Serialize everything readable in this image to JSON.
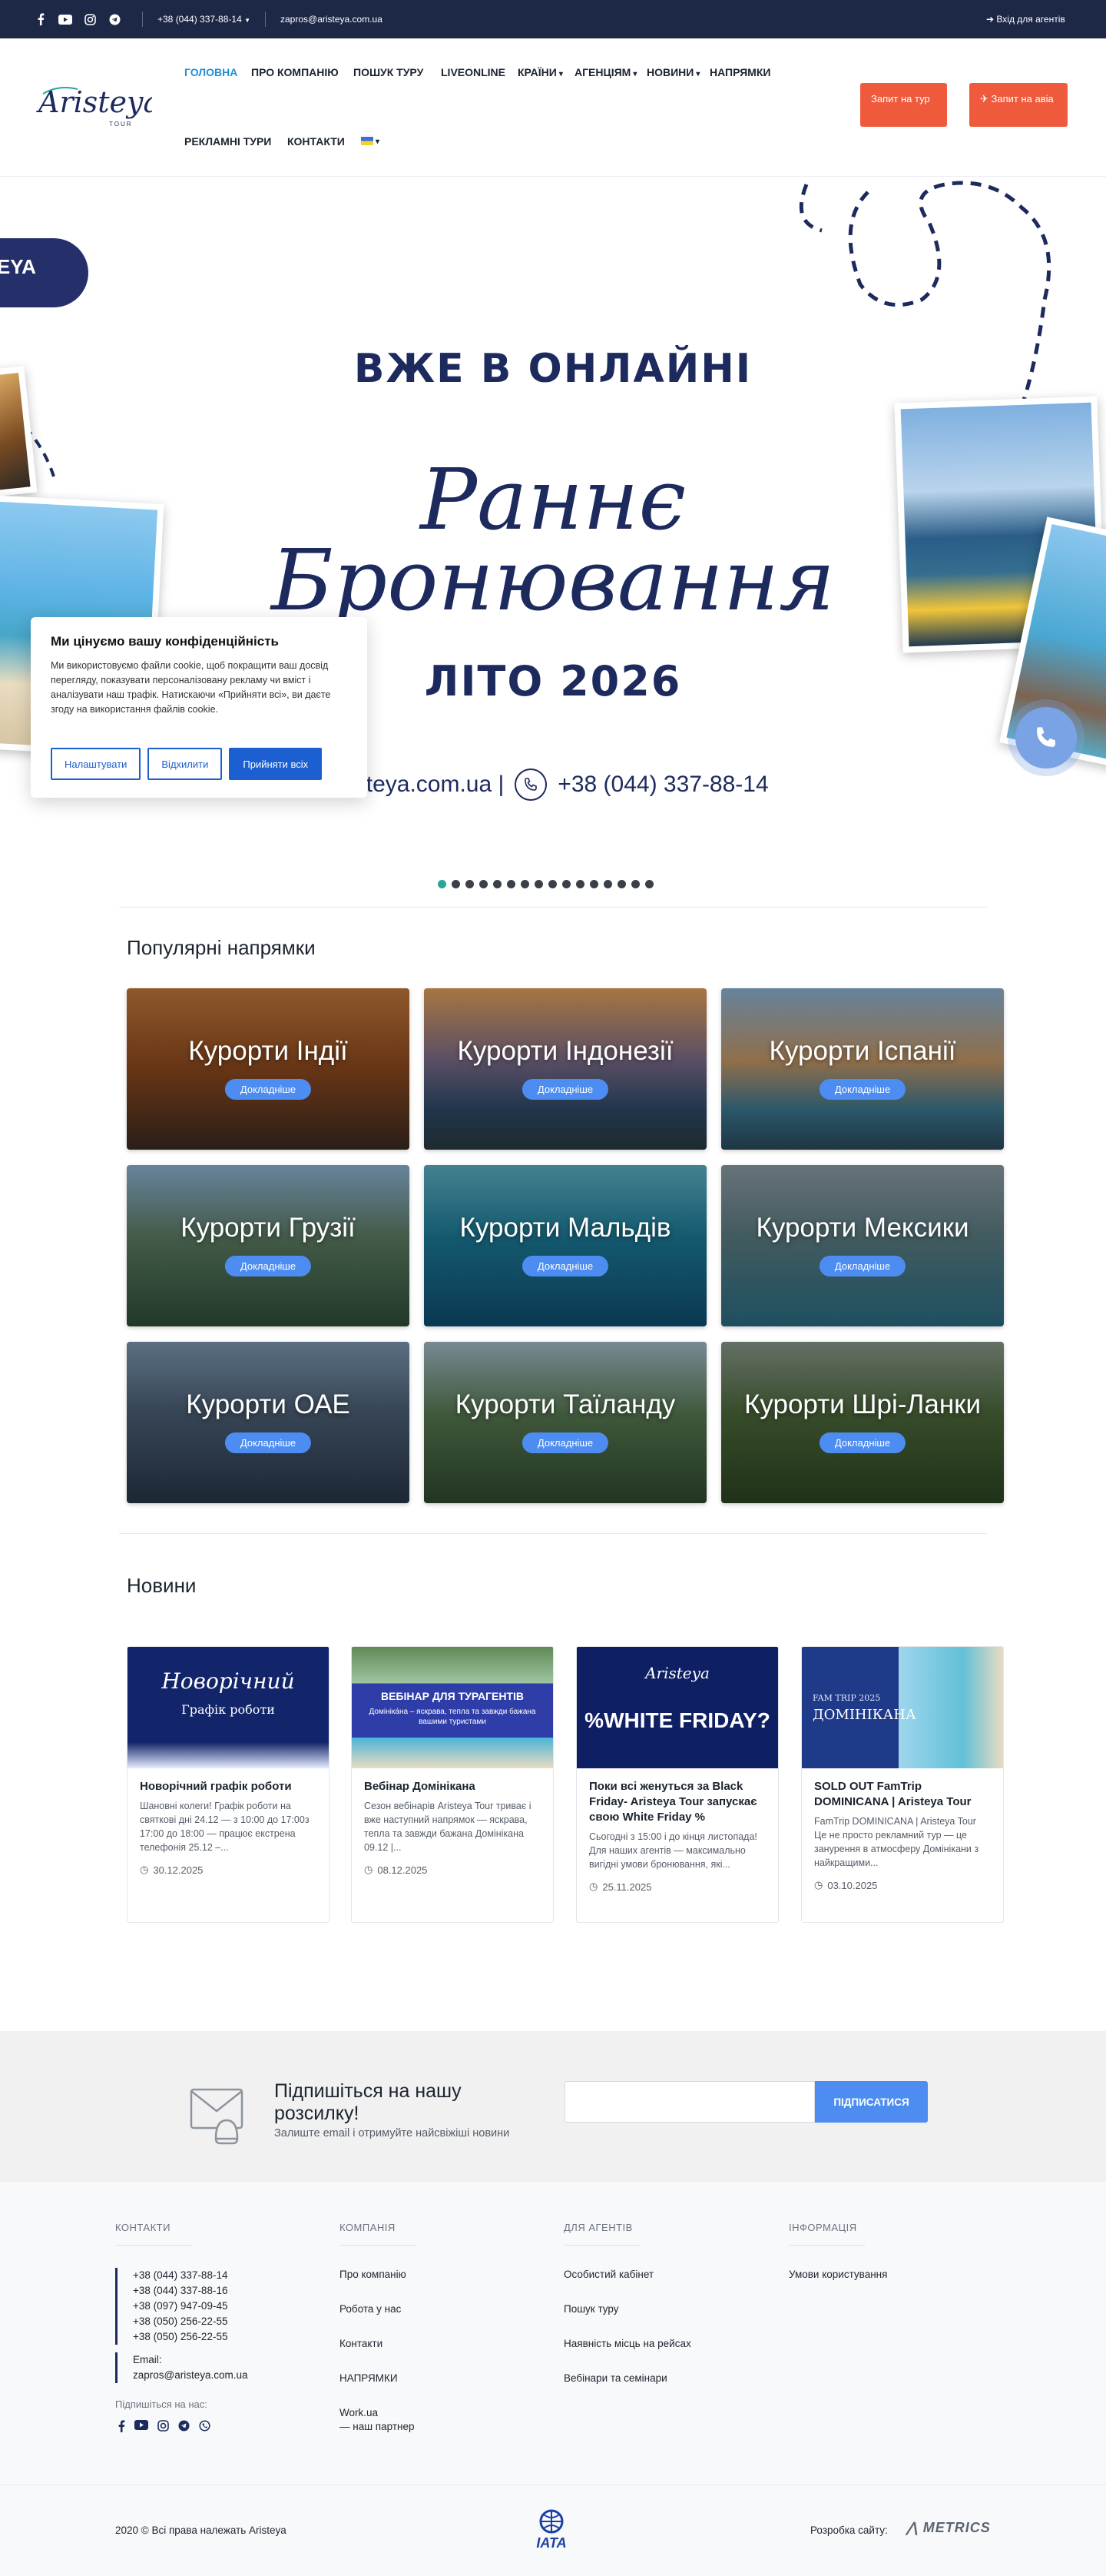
{
  "topbar": {
    "phone": "+38 (044) 337-88-14",
    "email": "zapros@aristeya.com.ua",
    "agent_login": "Вхід для агентів",
    "social_icons": [
      "facebook-icon",
      "youtube-icon",
      "instagram-icon",
      "telegram-icon"
    ]
  },
  "header": {
    "logo_text": "Aristeya",
    "logo_sub": "TOUR",
    "nav": {
      "home": "ГОЛОВНА",
      "about": "ПРО КОМПАНІЮ",
      "search": "ПОШУК ТУРУ",
      "liveonline": "LIVEONLINE",
      "countries": "КРАЇНИ",
      "agencies": "АГЕНЦІЯМ",
      "news": "НОВИНИ",
      "directions": "НАПРЯМКИ",
      "ad_tours": "РЕКЛАМНІ ТУРИ",
      "contacts": "КОНТАКТИ"
    },
    "btn_tour": "Запит на тур",
    "btn_avia": "Запит на авіа"
  },
  "hero": {
    "pill_text": "TEYA",
    "line1": "ВЖЕ В ОНЛАЙНІ",
    "script1": "Раннє",
    "script2": "Бронювання",
    "line2": "ЛІТО 2026",
    "site": "online.aristeya.com.ua |",
    "phone": "+38 (044) 337-88-14",
    "slides_total": 16,
    "slide_active": 1
  },
  "cookie": {
    "title": "Ми цінуємо вашу конфіденційність",
    "text": "Ми використовуємо файли cookie, щоб покращити ваш досвід перегляду, показувати персоналізовану рекламу чи вміст і аналізувати наш трафік. Натискаючи «Прийняти всі», ви даєте згоду на використання файлів cookie.",
    "btn_settings": "Налаштувати",
    "btn_reject": "Відхилити",
    "btn_accept": "Прийняти всіх"
  },
  "popular": {
    "title": "Популярні напрямки",
    "more_label": "Докладніше",
    "items": [
      {
        "name": "Курорти Індії"
      },
      {
        "name": "Курорти Індонезії"
      },
      {
        "name": "Курорти Іспанії"
      },
      {
        "name": "Курорти Грузії"
      },
      {
        "name": "Курорти Мальдів"
      },
      {
        "name": "Курорти Мексики"
      },
      {
        "name": "Курорти ОАЕ"
      },
      {
        "name": "Курорти Таїланду"
      },
      {
        "name": "Курорти Шрі-Ланки"
      }
    ]
  },
  "news": {
    "title": "Новини",
    "items": [
      {
        "image_line1": "Новорічний",
        "image_line2": "Графік роботи",
        "title": "Новорічний графік роботи",
        "text": "Шановні колеги! Графік роботи на святкові дні 24.12 — з 10:00 до 17:00з 17:00 до 18:00 — працює екстрена телефонія 25.12 –...",
        "date": "30.12.2025"
      },
      {
        "image_line1": "ВЕБІНАР ДЛЯ ТУРАГЕНТІВ",
        "image_line2": "Домініка́на – яскрава, тепла та завжди бажана вашими туристами",
        "title": "Вебінар Домінікана",
        "text": "Сезон вебінарів Aristeya Tour триває і вже наступний напрямок — яскрава, тепла та завжди бажана Домінікана 09.12 |...",
        "date": "08.12.2025"
      },
      {
        "image_line1": "Aristeya",
        "image_line2": "%WHITE FRIDAY?",
        "title": "Поки всі женуться за Black Friday- Aristeya Tour запускає свою White Friday %",
        "text": "  Сьогодні з 15:00 і до кінця листопада! Для наших агентів — максимально вигідні умови бронювання, які...",
        "date": "25.11.2025"
      },
      {
        "image_line1": "FAM TRIP 2025",
        "image_line2": "ДОМІНІКАНА",
        "title": "SOLD OUT FamTrip DOMINICANA | Aristeya Tour",
        "text": "FamTrip DOMINICANA | Aristeya Tour Це не просто рекламний тур — це занурення в атмосферу Домінікани з найкращими...",
        "date": "03.10.2025"
      }
    ]
  },
  "subscribe": {
    "title": "Підпишіться на нашу розсилку!",
    "subtitle": "Залиште email і отримуйте найсвіжіші новини",
    "button": "ПІДПИСАТИСЯ",
    "placeholder": ""
  },
  "footer": {
    "col_contacts": "КОНТАКТИ",
    "col_company": "КОМПАНІЯ",
    "col_agents": "ДЛЯ АГЕНТІВ",
    "col_info": "ІНФОРМАЦІЯ",
    "phones": [
      "+38 (044) 337-88-14",
      "+38 (044) 337-88-16",
      "+38 (097) 947-09-45",
      "+38 (050) 256-22-55",
      "+38 (050) 256-22-55"
    ],
    "email_label": "Email:",
    "email": "zapros@aristeya.com.ua",
    "follow_label": "Підпишіться на нас:",
    "company_links": [
      "Про компанію",
      "Робота у нас",
      "Контакти",
      "НАПРЯМКИ",
      "Work.ua",
      "— наш партнер"
    ],
    "agent_links": [
      "Особистий кабінет",
      "Пошук туру",
      "Наявність місць на рейсах",
      "Вебінари та семінари"
    ],
    "info_links": [
      "Умови користування"
    ],
    "copyright": "2020 © Всі права належать Aristeya",
    "iata": "IATA",
    "dev_label": "Розробка сайту:",
    "dev_name": "METRICS"
  },
  "colors": {
    "navy": "#1d2847",
    "accent_orange": "#ef5a3c",
    "accent_blue": "#4d8df2",
    "active_nav": "#1f8fd6"
  }
}
